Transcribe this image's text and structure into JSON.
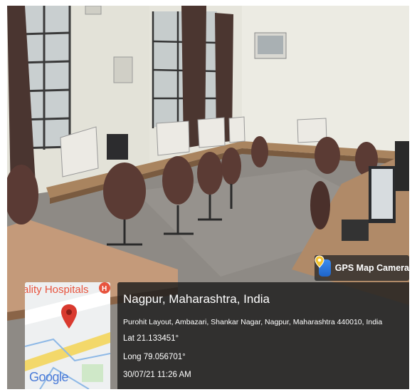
{
  "gps_badge": {
    "title": "GPS Map Camera",
    "icon": "map-pin-app-icon",
    "accent": "#2d7de0"
  },
  "map": {
    "poi_label": "ality Hospitals",
    "brand": "Google",
    "pin_color": "#d93a2f"
  },
  "location": {
    "title": "Nagpur, Maharashtra, India",
    "address": "Purohit Layout, Ambazari, Shankar Nagar, Nagpur, Maharashtra 440010, India",
    "lat": "Lat 21.133451°",
    "long": "Long 79.056701°",
    "datetime": "30/07/21 11:26 AM"
  },
  "scene_colors": {
    "wall": "#ecebe2",
    "floor": "#8f8b86",
    "desk": "#b28c6b",
    "chair": "#5a3a33",
    "curtain": "#4b3630"
  }
}
